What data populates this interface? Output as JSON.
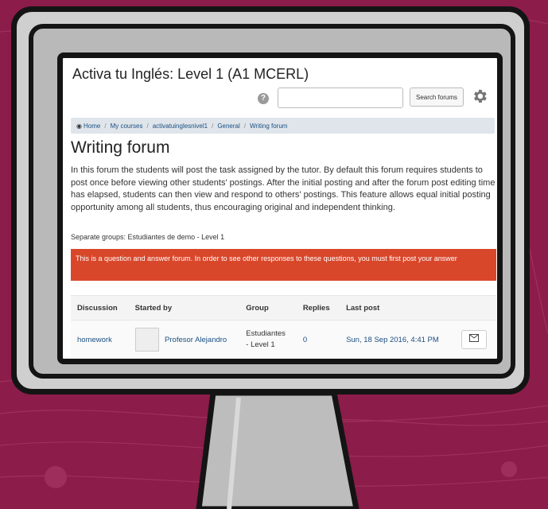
{
  "colors": {
    "background": "#8c1c4a",
    "alert": "#d9472b",
    "link": "#1b4f82",
    "breadcrumb_bg": "#dfe5ea"
  },
  "header": {
    "course_title": "Activa tu Inglés: Level 1 (A1 MCERL)",
    "help_icon": "question-mark-icon",
    "search_placeholder": "",
    "search_button": "Search forums",
    "settings_icon": "gear-icon"
  },
  "breadcrumb": {
    "home_icon": "dashboard-icon",
    "items": [
      "Home",
      "My courses",
      "activatuinglesnivel1",
      "General",
      "Writing forum"
    ]
  },
  "forum": {
    "title": "Writing forum",
    "intro": "In this forum the students will post the task assigned by the tutor. By default this forum requires students to post once before viewing other students' postings. After the initial posting and after the forum post editing time has elapsed, students can then view and respond to others' postings. This feature allows equal initial posting opportunity among all students, thus encouraging original and independent thinking.",
    "groups_label": "Separate groups: Estudiantes de demo - Level 1",
    "alert": "This is a question and answer forum. In order to see other responses to these questions, you must first post your answer"
  },
  "table": {
    "headers": [
      "Discussion",
      "Started by",
      "Group",
      "Replies",
      "Last post"
    ],
    "rows": [
      {
        "discussion": "homework",
        "started_by": "Profesor Alejandro",
        "group_line1": "Estudiantes",
        "group_line2": "- Level 1",
        "replies": "0",
        "last_post": "Sun, 18 Sep 2016, 4:41 PM",
        "action_icon": "envelope-icon"
      }
    ]
  }
}
